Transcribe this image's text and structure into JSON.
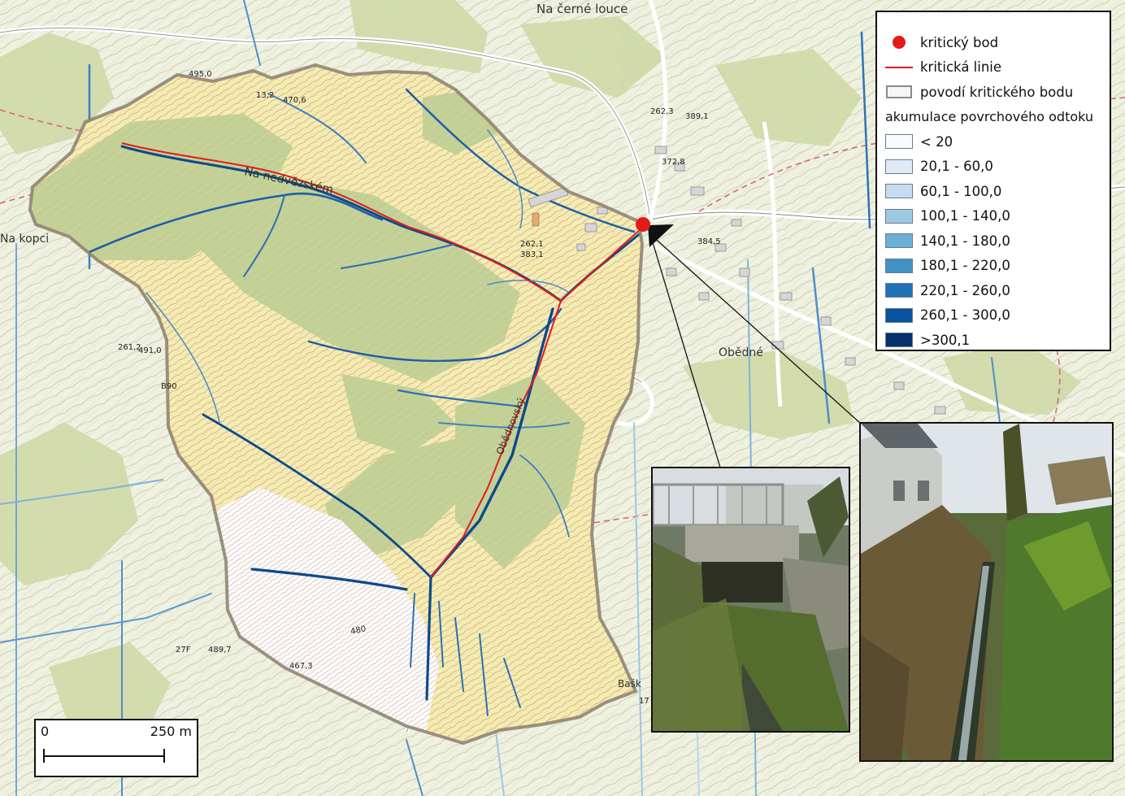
{
  "map": {
    "place_labels": [
      "Na černé louce",
      "Na kopci",
      "Na nedvězském",
      "Obědné",
      "Obědnovský",
      "Bašk"
    ],
    "spot_heights": [
      "495,0",
      "13,2",
      "470,6",
      "262,3",
      "389,1",
      "262,1",
      "383,1",
      "261,2",
      "491,0",
      "372,8",
      "384,5",
      "27F",
      "489,7",
      "467,3",
      "17",
      "B90",
      "480"
    ],
    "colors": {
      "critical": "#e41a1c",
      "stream_dark": "#0c4a8c",
      "basin_fill": "#f6ecb0",
      "forest": "#b5c98a"
    }
  },
  "legend": {
    "items": [
      {
        "label": "kritický bod",
        "symbol": "red-dot-icon"
      },
      {
        "label": "kritická linie",
        "symbol": "red-line-icon"
      },
      {
        "label": "povodí kritického bodu",
        "symbol": "basin-outline-icon"
      }
    ],
    "accumulation_title": "akumulace povrchového odtoku",
    "classes": [
      {
        "label": "< 20",
        "color": "#f7fbff"
      },
      {
        "label": "20,1 - 60,0",
        "color": "#deebf7"
      },
      {
        "label": "60,1 - 100,0",
        "color": "#c6dbef"
      },
      {
        "label": "100,1 - 140,0",
        "color": "#9ecae1"
      },
      {
        "label": "140,1 - 180,0",
        "color": "#6baed6"
      },
      {
        "label": "180,1 - 220,0",
        "color": "#4292c6"
      },
      {
        "label": "220,1 - 260,0",
        "color": "#2171b5"
      },
      {
        "label": "260,1 - 300,0",
        "color": "#08519c"
      },
      {
        "label": ">300,1",
        "color": "#08306b"
      }
    ]
  },
  "photos": [
    {
      "name": "photo-bridge-culvert",
      "subject": "bridge over stream"
    },
    {
      "name": "photo-stream-channel",
      "subject": "stream channel between gardens"
    }
  ],
  "scale_bar": {
    "start": "0",
    "distance": "250 m"
  }
}
